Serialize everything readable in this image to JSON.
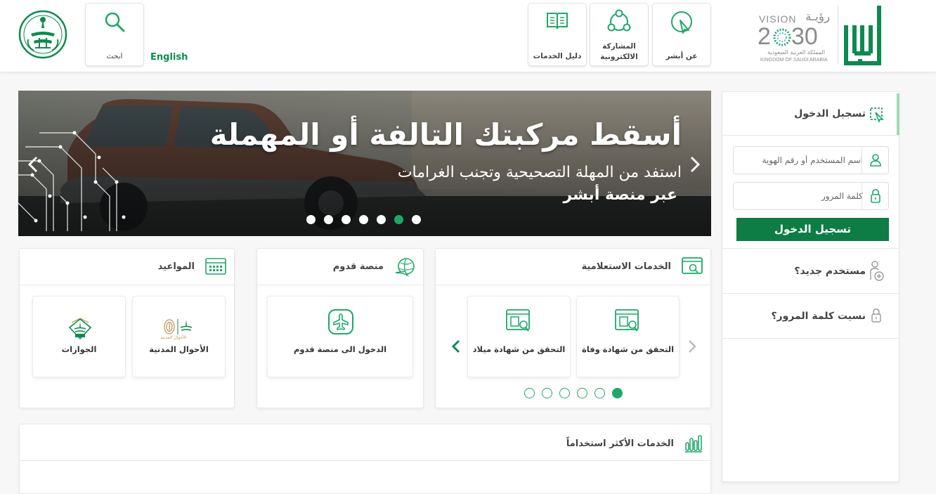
{
  "header": {
    "vision_ar": "رؤيـة",
    "vision_en": "VISION",
    "vision_year_a": "2",
    "vision_year_b": "30",
    "vision_kingdom_ar": "المملكة العربية السعودية",
    "vision_kingdom_en": "KINGDOM OF SAUDI ARABIA",
    "absher_logo_text": "أبشر",
    "nav": [
      {
        "label": "عن أبشر",
        "icon": "cursor-click-icon"
      },
      {
        "label_line1": "المشاركة",
        "label_line2": "الالكترونية",
        "icon": "people-network-icon"
      },
      {
        "label": "دليل الخدمات",
        "icon": "book-icon"
      }
    ],
    "language_link": "English",
    "search_label": "ابحث",
    "moi_emblem": "ministry-emblem-icon"
  },
  "banner": {
    "title": "أسقط مركبتك التالفة أو المهملة",
    "subtitle": "استفد من المهلة التصحيحية وتجنب الغرامات",
    "tagline": "عبر منصة أبشر",
    "slide_count": 7,
    "active_slide": 6
  },
  "login": {
    "header": "تسجيل الدخول",
    "username_placeholder": "اسم المستخدم أو رقم الهوية",
    "password_placeholder": "كلمة المرور",
    "submit_label": "تسجيل الدخول",
    "new_user": "مستخدم جديد؟",
    "forgot_password": "نسيت كلمة المرور؟"
  },
  "inquiry": {
    "title": "الخدمات الاستعلامية",
    "items": [
      {
        "label": "التحقق من شهادة وفاة"
      },
      {
        "label": "التحقق من شهادة ميلاد"
      }
    ],
    "page_count": 6,
    "active_page": 6
  },
  "arrival": {
    "title": "منصة قدوم",
    "items": [
      {
        "label": "الدخول الى منصة قدوم"
      }
    ]
  },
  "appointments": {
    "title": "المواعيد",
    "items": [
      {
        "label": "الأحوال المدنية",
        "logo_text": "الأحوال المدنية"
      },
      {
        "label": "الجوازات"
      }
    ]
  },
  "most_used": {
    "title": "الخدمات الأكثر استخداماً"
  },
  "colors": {
    "primary": "#0e8a4f",
    "accent": "#1ea868",
    "button": "#0d7d45",
    "light_green_bar": "#9fdab6"
  }
}
